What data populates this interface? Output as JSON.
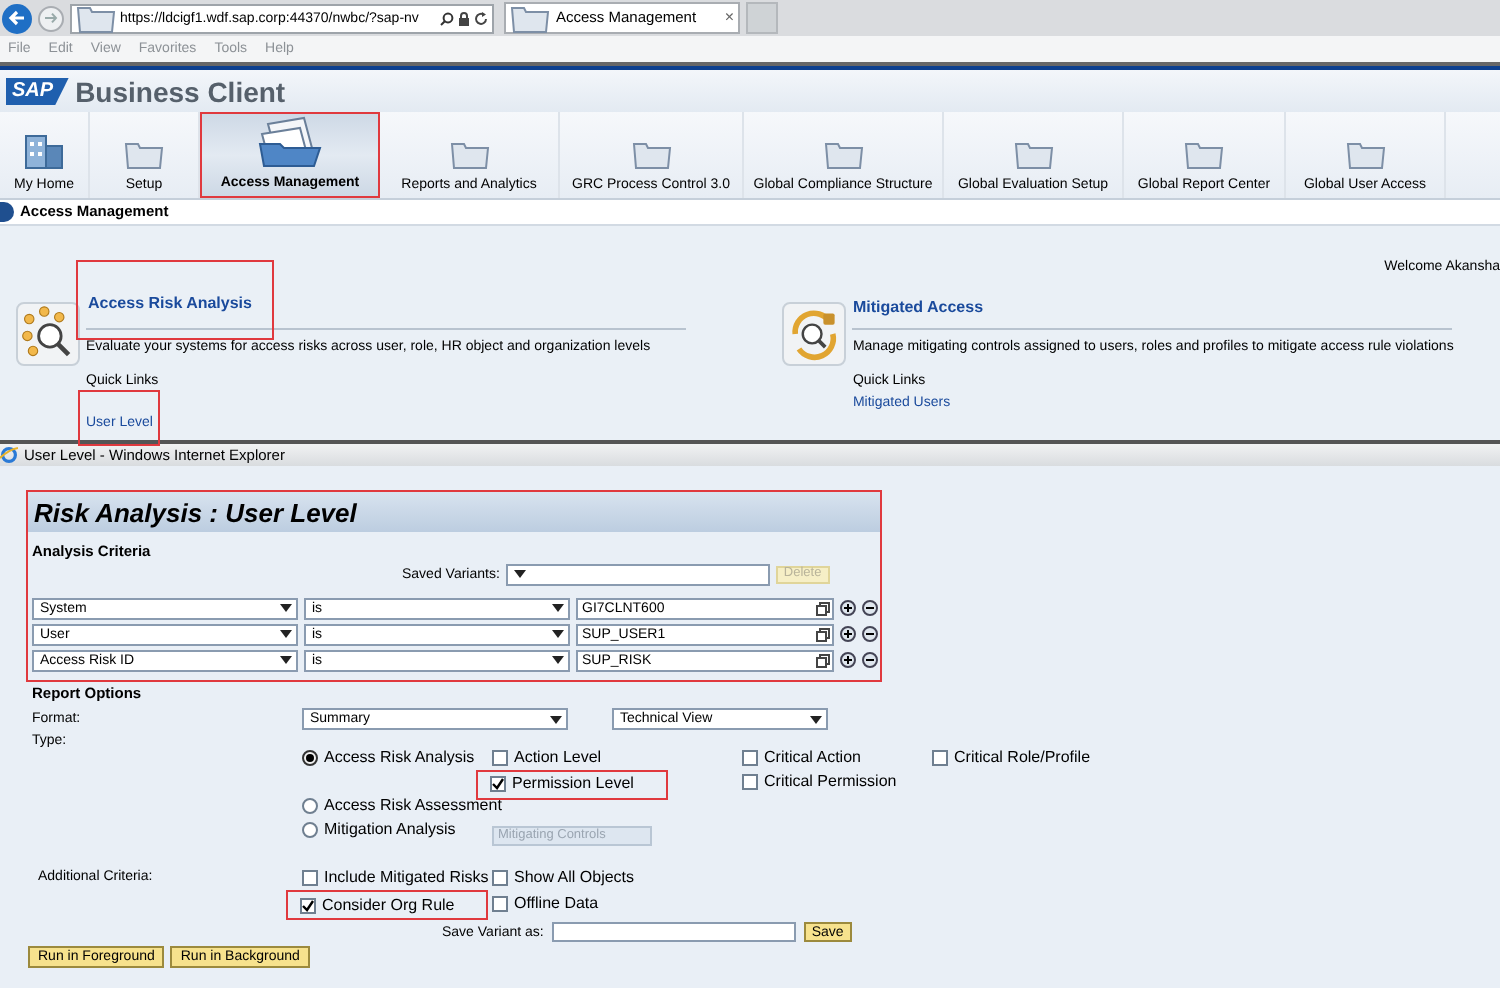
{
  "browser": {
    "url": "https://ldcigf1.wdf.sap.corp:44370/nwbc/?sap-nv",
    "tab_title": "Access Management",
    "close": "×",
    "menu": [
      "File",
      "Edit",
      "View",
      "Favorites",
      "Tools",
      "Help"
    ]
  },
  "header": {
    "logo": "SAP",
    "title": "Business Client"
  },
  "nav": [
    {
      "label": "My Home",
      "kind": "home",
      "selected": false,
      "highlighted": false
    },
    {
      "label": "Setup",
      "kind": "folder",
      "selected": false,
      "highlighted": false
    },
    {
      "label": "Access Management",
      "kind": "folders",
      "selected": true,
      "highlighted": true
    },
    {
      "label": "Reports and Analytics",
      "kind": "folder",
      "selected": false,
      "highlighted": false
    },
    {
      "label": "GRC Process Control 3.0",
      "kind": "folder",
      "selected": false,
      "highlighted": false
    },
    {
      "label": "Global Compliance Structure",
      "kind": "folder",
      "selected": false,
      "highlighted": false
    },
    {
      "label": "Global Evaluation Setup",
      "kind": "folder",
      "selected": false,
      "highlighted": false
    },
    {
      "label": "Global Report Center",
      "kind": "folder",
      "selected": false,
      "highlighted": false
    },
    {
      "label": "Global User Access",
      "kind": "folder",
      "selected": false,
      "highlighted": false
    }
  ],
  "breadcrumb": "Access Management",
  "welcome": "Welcome Akansha",
  "cards": [
    {
      "title": "Access Risk Analysis",
      "kind": "analysis",
      "highlighted": true,
      "description": "Evaluate your systems for access risks across user, role, HR object and organization levels",
      "quick_links_label": "Quick Links",
      "links": [
        {
          "label": "User Level",
          "highlighted": true
        }
      ]
    },
    {
      "title": "Mitigated Access",
      "kind": "mitigation",
      "highlighted": false,
      "description": "Manage mitigating controls assigned to users, roles and profiles to mitigate access rule violations",
      "quick_links_label": "Quick Links",
      "links": [
        {
          "label": "Mitigated Users",
          "highlighted": false
        }
      ]
    }
  ],
  "popup": {
    "title": "User Level - Windows Internet Explorer"
  },
  "form": {
    "title": "Risk Analysis : User Level",
    "highlighted": true,
    "criteria_heading": "Analysis Criteria",
    "saved_variants_label": "Saved Variants:",
    "delete_button": {
      "label": "Delete",
      "disabled": true
    },
    "criteria": [
      {
        "field": "System",
        "operator": "is",
        "value": "GI7CLNT600"
      },
      {
        "field": "User",
        "operator": "is",
        "value": "SUP_USER1"
      },
      {
        "field": "Access Risk ID",
        "operator": "is",
        "value": "SUP_RISK"
      }
    ],
    "report_options_heading": "Report Options",
    "format_label": "Format:",
    "format": "Summary",
    "view": "Technical View",
    "type_label": "Type:",
    "radios": [
      {
        "label": "Access Risk Analysis",
        "selected": true
      },
      {
        "label": "Access Risk Assessment",
        "selected": false
      },
      {
        "label": "Mitigation Analysis",
        "selected": false
      }
    ],
    "mitigating_controls": {
      "placeholder": "Mitigating Controls",
      "disabled": true
    },
    "type_checks": [
      [
        {
          "label": "Action Level",
          "checked": false,
          "highlighted": false
        },
        {
          "label": "Permission Level",
          "checked": true,
          "highlighted": true
        }
      ],
      [
        {
          "label": "Critical Action",
          "checked": false,
          "highlighted": false
        },
        {
          "label": "Critical Permission",
          "checked": false,
          "highlighted": false
        }
      ],
      [
        {
          "label": "Critical Role/Profile",
          "checked": false,
          "highlighted": false
        }
      ]
    ],
    "additional_label": "Additional Criteria:",
    "additional_checks": [
      [
        {
          "label": "Include Mitigated Risks",
          "checked": false,
          "highlighted": false
        },
        {
          "label": "Consider Org Rule",
          "checked": true,
          "highlighted": true
        }
      ],
      [
        {
          "label": "Show All Objects",
          "checked": false,
          "highlighted": false
        },
        {
          "label": "Offline Data",
          "checked": false,
          "highlighted": false
        }
      ]
    ],
    "save_variant_label": "Save Variant as:",
    "save_button": "Save",
    "run_buttons": [
      "Run in Foreground",
      "Run in Background"
    ]
  }
}
